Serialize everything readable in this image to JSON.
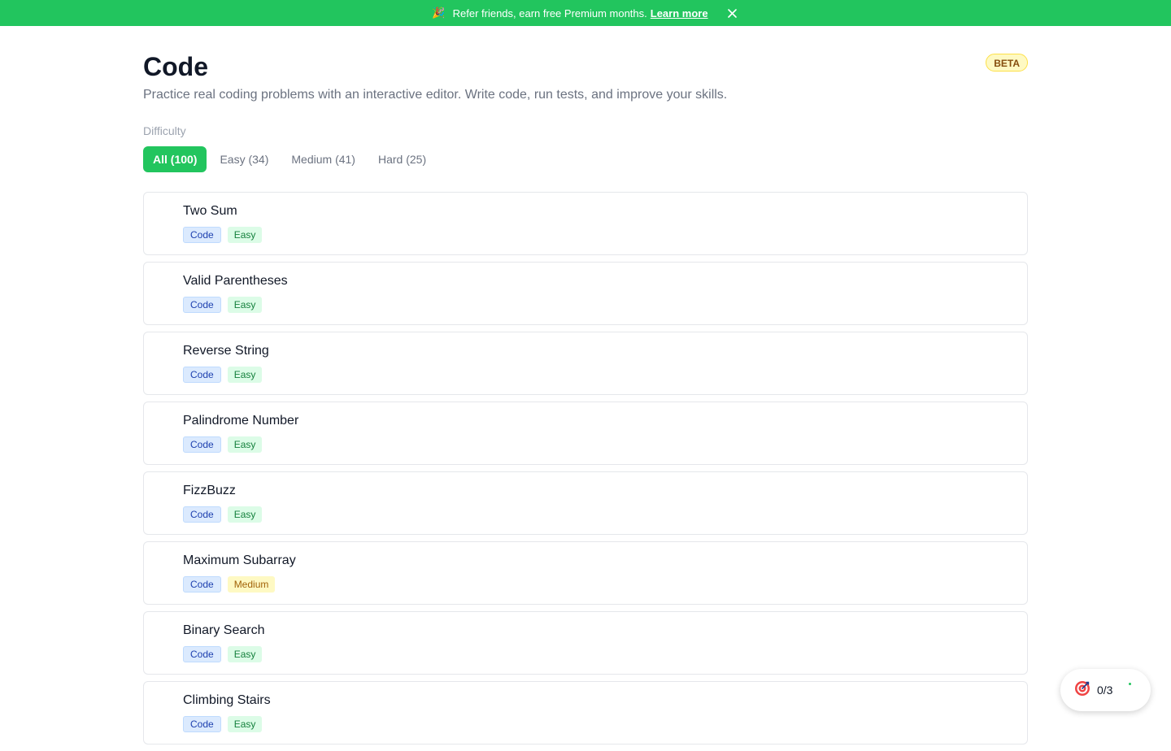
{
  "banner": {
    "icon": "party-popper-icon",
    "message": "Refer friends, earn free Premium months.",
    "link_label": "Learn more",
    "close_icon": "close-icon"
  },
  "header": {
    "title": "Code",
    "badge": "BETA",
    "subtitle": "Practice real coding problems with an interactive editor. Write code, run tests, and improve your skills."
  },
  "filters": {
    "label": "Difficulty",
    "options": [
      {
        "label": "All (100)",
        "active": true
      },
      {
        "label": "Easy (34)",
        "active": false
      },
      {
        "label": "Medium (41)",
        "active": false
      },
      {
        "label": "Hard (25)",
        "active": false
      }
    ]
  },
  "problems": [
    {
      "title": "Two Sum",
      "type": "Code",
      "difficulty": "Easy"
    },
    {
      "title": "Valid Parentheses",
      "type": "Code",
      "difficulty": "Easy"
    },
    {
      "title": "Reverse String",
      "type": "Code",
      "difficulty": "Easy"
    },
    {
      "title": "Palindrome Number",
      "type": "Code",
      "difficulty": "Easy"
    },
    {
      "title": "FizzBuzz",
      "type": "Code",
      "difficulty": "Easy"
    },
    {
      "title": "Maximum Subarray",
      "type": "Code",
      "difficulty": "Medium"
    },
    {
      "title": "Binary Search",
      "type": "Code",
      "difficulty": "Easy"
    },
    {
      "title": "Climbing Stairs",
      "type": "Code",
      "difficulty": "Easy"
    }
  ],
  "goal_widget": {
    "icon": "target-icon",
    "progress": "0/3"
  },
  "colors": {
    "accent": "#22c55e",
    "code_tag": "#dbeafe",
    "easy_tag": "#dcfce7",
    "medium_tag": "#fef9c3",
    "beta_badge": "#fef9c3"
  }
}
